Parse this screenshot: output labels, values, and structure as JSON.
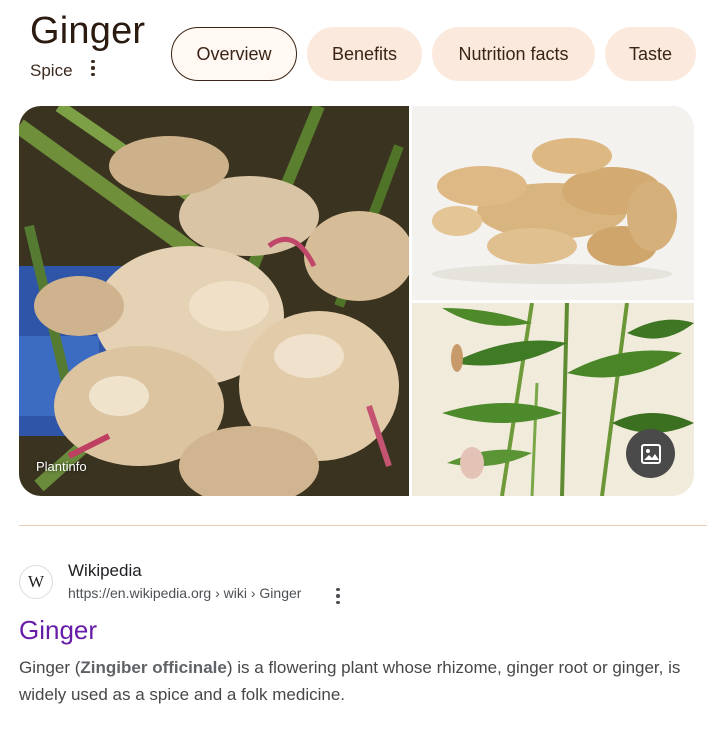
{
  "header": {
    "title": "Ginger",
    "subtitle": "Spice"
  },
  "chips": [
    {
      "label": "Overview",
      "active": true
    },
    {
      "label": "Benefits",
      "active": false
    },
    {
      "label": "Nutrition facts",
      "active": false
    },
    {
      "label": "Taste",
      "active": false
    }
  ],
  "images": {
    "main_credit": "Plantinfo",
    "main_icon": "ginger-root-photo",
    "top_icon": "ginger-root-photo",
    "bottom_icon": "ginger-plant-illustration",
    "more_images_icon": "image-icon"
  },
  "result": {
    "favicon_letter": "W",
    "site_name": "Wikipedia",
    "url": "https://en.wikipedia.org › wiki › Ginger",
    "title": "Ginger",
    "snippet_pre": "Ginger (",
    "snippet_bold": "Zingiber officinale",
    "snippet_post": ") is a flowering plant whose rhizome, ginger root or ginger, is widely used as a spice and a folk medicine."
  },
  "colors": {
    "chip_bg": "#fbe9dd",
    "title_link": "#681da8",
    "divider": "#e8cdb8"
  }
}
